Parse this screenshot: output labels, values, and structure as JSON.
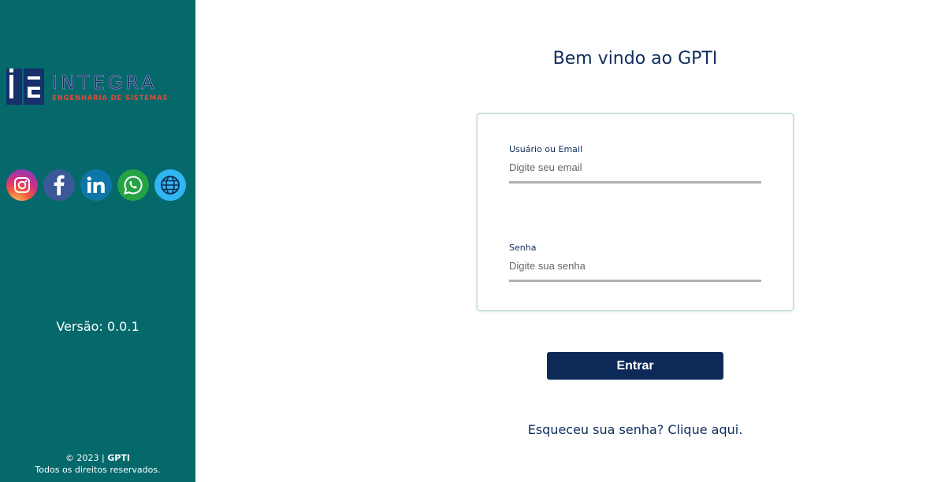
{
  "sidebar": {
    "logo": {
      "name": "INTEGRA",
      "subtitle": "ENGENHARIA DE SISTEMAS"
    },
    "social": [
      {
        "icon": "instagram-icon"
      },
      {
        "icon": "facebook-icon"
      },
      {
        "icon": "linkedin-icon"
      },
      {
        "icon": "whatsapp-icon"
      },
      {
        "icon": "globe-icon"
      }
    ],
    "version": "Versão: 0.0.1",
    "footer": {
      "copyright_prefix": "© 2023 | ",
      "brand": "GPTI",
      "rights": "Todos os direitos reservados."
    }
  },
  "main": {
    "title": "Bem vindo ao GPTI",
    "user": {
      "label": "Usuário ou Email",
      "placeholder": "Digite seu email",
      "value": ""
    },
    "password": {
      "label": "Senha",
      "placeholder": "Digite sua senha",
      "value": ""
    },
    "submit_label": "Entrar",
    "forgot_text": "Esqueceu sua senha? Clique aqui."
  },
  "colors": {
    "sidebar": "#05696b",
    "primary": "#0c2958",
    "text": "#0d2d5c"
  }
}
